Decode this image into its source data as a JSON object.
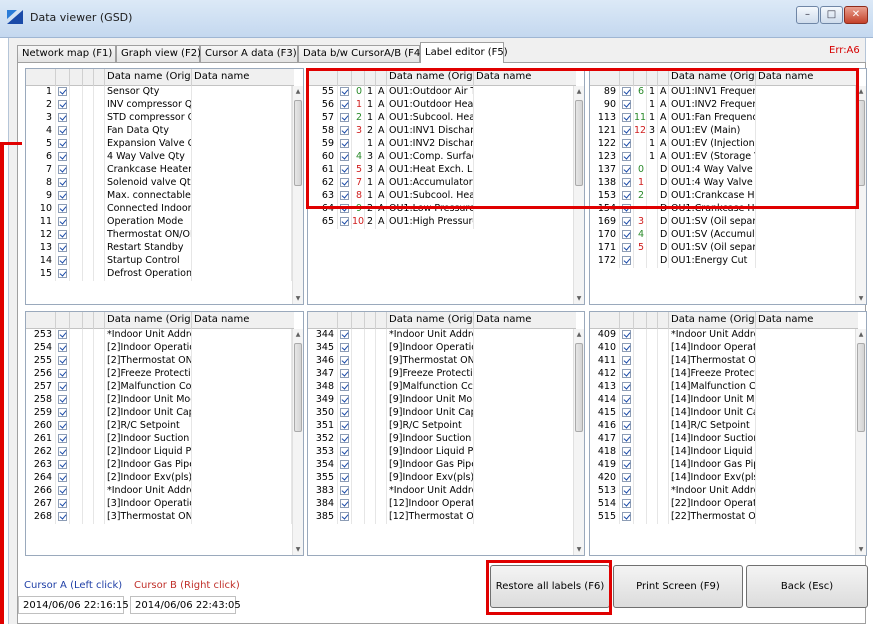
{
  "window": {
    "title": "Data viewer (GSD)",
    "min_label": "–",
    "max_label": "□",
    "close_label": "✕"
  },
  "tabs": [
    "Network map (F1)",
    "Graph view (F2)",
    "Cursor A data (F3)",
    "Data b/w CursorA/B (F4)",
    "Label editor (F5)"
  ],
  "error_text": "Err:A6",
  "columns": {
    "name_original": "Data name (Origin",
    "name": "Data name"
  },
  "grids": {
    "top_left": [
      [
        "1",
        "",
        "",
        "",
        "Sensor Qty"
      ],
      [
        "2",
        "",
        "",
        "",
        "INV compressor Q"
      ],
      [
        "3",
        "",
        "",
        "",
        "STD compressor Q"
      ],
      [
        "4",
        "",
        "",
        "",
        "Fan Data Qty"
      ],
      [
        "5",
        "",
        "",
        "",
        "Expansion Valve Q"
      ],
      [
        "6",
        "",
        "",
        "",
        "4 Way Valve Qty"
      ],
      [
        "7",
        "",
        "",
        "",
        "Crankcase Heater ("
      ],
      [
        "8",
        "",
        "",
        "",
        "Solenoid valve Qty"
      ],
      [
        "9",
        "",
        "",
        "",
        "Max. connectable i"
      ],
      [
        "10",
        "",
        "",
        "",
        "Connected Indoor"
      ],
      [
        "11",
        "",
        "",
        "",
        "Operation Mode"
      ],
      [
        "12",
        "",
        "",
        "",
        "Thermostat ON/OF"
      ],
      [
        "13",
        "",
        "",
        "",
        "Restart Standby"
      ],
      [
        "14",
        "",
        "",
        "",
        "Startup Control"
      ],
      [
        "15",
        "",
        "",
        "",
        "Defrost Operation"
      ]
    ],
    "top_mid": [
      [
        "55",
        "0",
        "1",
        "A",
        "OU1:Outdoor Air T"
      ],
      [
        "56",
        "1",
        "1",
        "A",
        "OU1:Outdoor Heat"
      ],
      [
        "57",
        "2",
        "1",
        "A",
        "OU1:Subcool. Heat"
      ],
      [
        "58",
        "3",
        "2",
        "A",
        "OU1:INV1 Dischard"
      ],
      [
        "59",
        "",
        "1",
        "A",
        "OU1:INV2 Dischard"
      ],
      [
        "60",
        "4",
        "3",
        "A",
        "OU1:Comp. Surfac"
      ],
      [
        "61",
        "5",
        "3",
        "A",
        "OU1:Heat Exch. Liq"
      ],
      [
        "62",
        "7",
        "1",
        "A",
        "OU1:Accumulator I"
      ],
      [
        "63",
        "8",
        "1",
        "A",
        "OU1:Subcool. Heat"
      ],
      [
        "64",
        "9",
        "2",
        "A",
        "OU1:Low Pressure"
      ],
      [
        "65",
        "10",
        "2",
        "A",
        "OU1:High Pressure"
      ]
    ],
    "top_right": [
      [
        "89",
        "6",
        "1",
        "A",
        "OU1:INV1 Frequen"
      ],
      [
        "90",
        "",
        "1",
        "A",
        "OU1:INV2 Frequen"
      ],
      [
        "113",
        "11",
        "1",
        "A",
        "OU1:Fan Frequency"
      ],
      [
        "121",
        "12",
        "3",
        "A",
        "OU1:EV (Main)"
      ],
      [
        "122",
        "",
        "1",
        "A",
        "OU1:EV (Injection)"
      ],
      [
        "123",
        "",
        "1",
        "A",
        "OU1:EV (Storage V"
      ],
      [
        "137",
        "0",
        "",
        "D",
        "OU1:4 Way Valve"
      ],
      [
        "138",
        "1",
        "",
        "D",
        "OU1:4 Way Valve ("
      ],
      [
        "153",
        "2",
        "",
        "D",
        "OU1:Crankcase He"
      ],
      [
        "154",
        "",
        "",
        "D",
        "OU1:Crankcase He"
      ],
      [
        "169",
        "3",
        "",
        "D",
        "OU1:SV (Oil separa"
      ],
      [
        "170",
        "4",
        "",
        "D",
        "OU1:SV (Accumula"
      ],
      [
        "171",
        "5",
        "",
        "D",
        "OU1:SV (Oil separa"
      ],
      [
        "172",
        "",
        "",
        "D",
        "OU1:Energy Cut"
      ]
    ],
    "bottom_left": [
      [
        "253",
        "",
        "",
        "",
        "*Indoor Unit Addre"
      ],
      [
        "254",
        "",
        "",
        "",
        "[2]Indoor Operatio"
      ],
      [
        "255",
        "",
        "",
        "",
        "[2]Thermostat ON/"
      ],
      [
        "256",
        "",
        "",
        "",
        "[2]Freeze Protectio"
      ],
      [
        "257",
        "",
        "",
        "",
        "[2]Malfunction Coc"
      ],
      [
        "258",
        "",
        "",
        "",
        "[2]Indoor Unit Moc"
      ],
      [
        "259",
        "",
        "",
        "",
        "[2]Indoor Unit Cap"
      ],
      [
        "260",
        "",
        "",
        "",
        "[2]R/C Setpoint"
      ],
      [
        "261",
        "",
        "",
        "",
        "[2]Indoor Suction /"
      ],
      [
        "262",
        "",
        "",
        "",
        "[2]Indoor Liquid Pi"
      ],
      [
        "263",
        "",
        "",
        "",
        "[2]Indoor Gas Pipe"
      ],
      [
        "264",
        "",
        "",
        "",
        "[2]Indoor Exv(pls)"
      ],
      [
        "266",
        "",
        "",
        "",
        "*Indoor Unit Addre"
      ],
      [
        "267",
        "",
        "",
        "",
        "[3]Indoor Operatio"
      ],
      [
        "268",
        "",
        "",
        "",
        "[3]Thermostat ON/"
      ]
    ],
    "bottom_mid": [
      [
        "344",
        "",
        "",
        "",
        "*Indoor Unit Addre"
      ],
      [
        "345",
        "",
        "",
        "",
        "[9]Indoor Operatio"
      ],
      [
        "346",
        "",
        "",
        "",
        "[9]Thermostat ON/"
      ],
      [
        "347",
        "",
        "",
        "",
        "[9]Freeze Protectio"
      ],
      [
        "348",
        "",
        "",
        "",
        "[9]Malfunction Cc"
      ],
      [
        "349",
        "",
        "",
        "",
        "[9]Indoor Unit Mo"
      ],
      [
        "350",
        "",
        "",
        "",
        "[9]Indoor Unit Cap"
      ],
      [
        "351",
        "",
        "",
        "",
        "[9]R/C Setpoint"
      ],
      [
        "352",
        "",
        "",
        "",
        "[9]Indoor Suction /"
      ],
      [
        "353",
        "",
        "",
        "",
        "[9]Indoor Liquid Pi"
      ],
      [
        "354",
        "",
        "",
        "",
        "[9]Indoor Gas Pipe"
      ],
      [
        "355",
        "",
        "",
        "",
        "[9]Indoor Exv(pls)"
      ],
      [
        "383",
        "",
        "",
        "",
        "*Indoor Unit Addre"
      ],
      [
        "384",
        "",
        "",
        "",
        "[12]Indoor Operati"
      ],
      [
        "385",
        "",
        "",
        "",
        "[12]Thermostat ON"
      ]
    ],
    "bottom_right": [
      [
        "409",
        "",
        "",
        "",
        "*Indoor Unit Addre"
      ],
      [
        "410",
        "",
        "",
        "",
        "[14]Indoor Operati"
      ],
      [
        "411",
        "",
        "",
        "",
        "[14]Thermostat ON"
      ],
      [
        "412",
        "",
        "",
        "",
        "[14]Freeze Protecti"
      ],
      [
        "413",
        "",
        "",
        "",
        "[14]Malfunction Cc"
      ],
      [
        "414",
        "",
        "",
        "",
        "[14]Indoor Unit Mc"
      ],
      [
        "415",
        "",
        "",
        "",
        "[14]Indoor Unit Ca"
      ],
      [
        "416",
        "",
        "",
        "",
        "[14]R/C Setpoint"
      ],
      [
        "417",
        "",
        "",
        "",
        "[14]Indoor Suction"
      ],
      [
        "418",
        "",
        "",
        "",
        "[14]Indoor Liquid F"
      ],
      [
        "419",
        "",
        "",
        "",
        "[14]Indoor Gas Pip"
      ],
      [
        "420",
        "",
        "",
        "",
        "[14]Indoor Exv(pls)"
      ],
      [
        "513",
        "",
        "",
        "",
        "*Indoor Unit Addre"
      ],
      [
        "514",
        "",
        "",
        "",
        "[22]Indoor Operati"
      ],
      [
        "515",
        "",
        "",
        "",
        "[22]Thermostat ON"
      ]
    ]
  },
  "cursor": {
    "a_label": "Cursor A (Left click)",
    "b_label": "Cursor B (Right click)",
    "a_time": "2014/06/06 22:16:15",
    "b_time": "2014/06/06 22:43:05"
  },
  "buttons": {
    "restore": "Restore all labels (F6)",
    "print": "Print Screen (F9)",
    "back": "Back (Esc)"
  },
  "colors": {
    "highlight": "#e00000",
    "cursor_a": "#1f3fa6",
    "cursor_b": "#c0302a"
  }
}
